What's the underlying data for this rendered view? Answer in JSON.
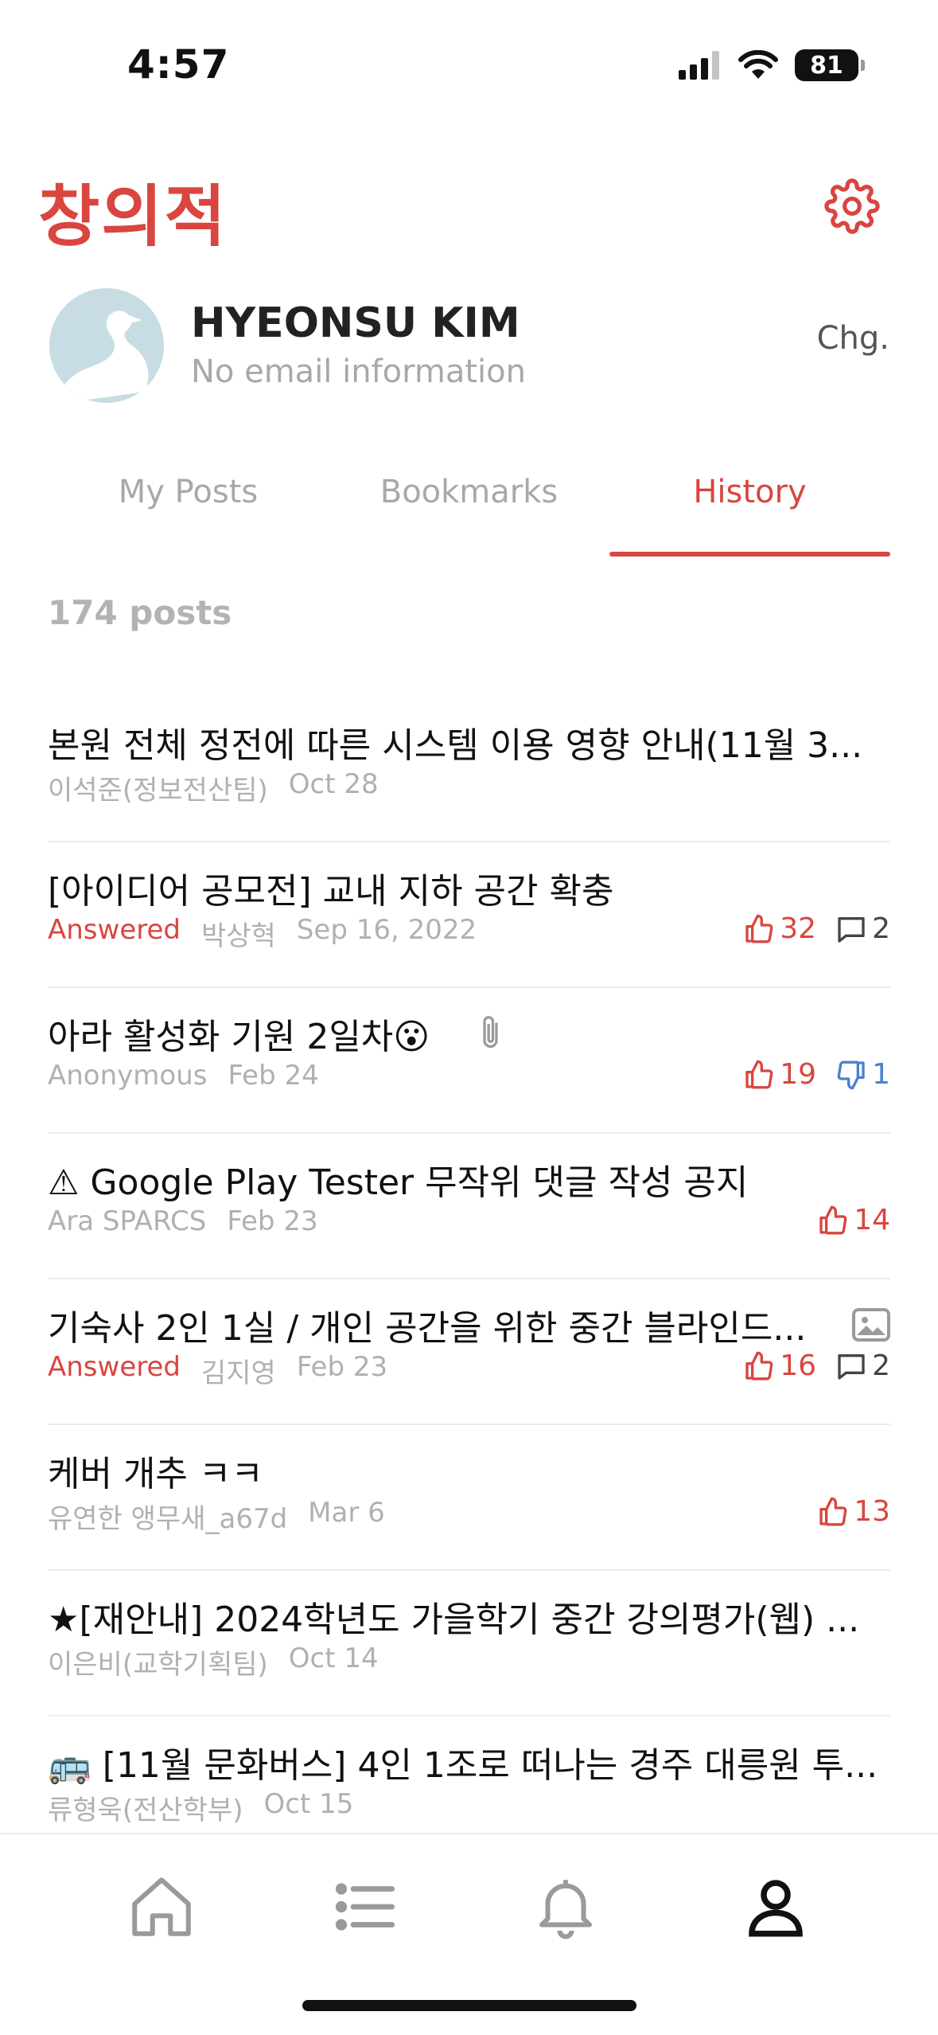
{
  "status_bar": {
    "time": "4:57",
    "battery": "81"
  },
  "header": {
    "title": "창의적"
  },
  "profile": {
    "name": "HYEONSU KIM",
    "email": "No email information",
    "change_label": "Chg."
  },
  "tabs": [
    {
      "label": "My Posts",
      "active": false
    },
    {
      "label": "Bookmarks",
      "active": false
    },
    {
      "label": "History",
      "active": true
    }
  ],
  "post_count": "174 posts",
  "posts": [
    {
      "title": "본원 전체 정전에 따른 시스템 이용 영향 안내(11월 3...",
      "status": "",
      "author": "이석준(정보전산팀)",
      "date": "Oct 28",
      "likes": "",
      "dislikes": "",
      "comments": ""
    },
    {
      "title": "[아이디어 공모전] 교내 지하 공간 확충",
      "status": "Answered",
      "author": "박상혁",
      "date": "Sep 16, 2022",
      "likes": "32",
      "dislikes": "",
      "comments": "2"
    },
    {
      "title": "아라 활성화 기원 2일차😮",
      "status": "",
      "author": "Anonymous",
      "date": "Feb 24",
      "likes": "19",
      "dislikes": "1",
      "comments": "",
      "attachment": "paperclip-icon"
    },
    {
      "title": "⚠ Google Play Tester 무작위 댓글 작성 공지",
      "status": "",
      "author": "Ara SPARCS",
      "date": "Feb 23",
      "likes": "14",
      "dislikes": "",
      "comments": ""
    },
    {
      "title": "기숙사 2인 1실 / 개인 공간을 위한 중간 블라인드...",
      "status": "Answered",
      "author": "김지영",
      "date": "Feb 23",
      "likes": "16",
      "dislikes": "",
      "comments": "2",
      "attachment": "image-icon"
    },
    {
      "title": "케버 개추 ㅋㅋ",
      "status": "",
      "author": "유연한 앵무새_a67d",
      "date": "Mar 6",
      "likes": "13",
      "dislikes": "",
      "comments": ""
    },
    {
      "title": "★[재안내] 2024학년도 가을학기 중간 강의평가(웹) ...",
      "status": "",
      "author": "이은비(교학기획팀)",
      "date": "Oct 14",
      "likes": "",
      "dislikes": "",
      "comments": ""
    },
    {
      "title": "🚌 [11월 문화버스] 4인 1조로 떠나는 경주 대릉원 투...",
      "status": "",
      "author": "류형욱(전산학부)",
      "date": "Oct 15",
      "likes": "",
      "dislikes": "",
      "comments": ""
    }
  ],
  "bottom_nav": [
    {
      "icon": "home-icon",
      "active": false
    },
    {
      "icon": "list-icon",
      "active": false
    },
    {
      "icon": "bell-icon",
      "active": false
    },
    {
      "icon": "person-icon",
      "active": true
    }
  ],
  "colors": {
    "accent": "#d9453f",
    "dislike": "#4a7fd1",
    "muted": "#b0b0b0"
  }
}
